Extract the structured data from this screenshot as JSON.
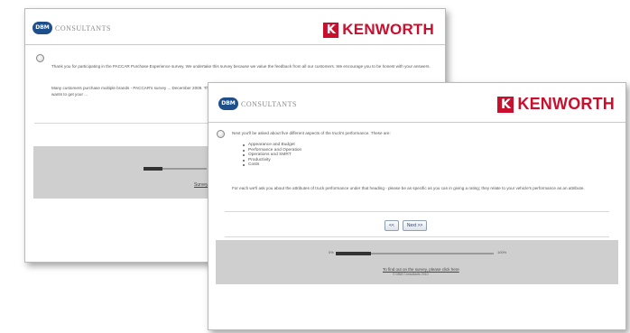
{
  "back_window": {
    "logo_badge": "DBM",
    "logo_text": "CONSULTANTS",
    "brand_mark": "K",
    "brand_name": "KENWORTH",
    "paragraph_1": "Thank you for participating in the PACCAR Purchase Experience survey. We undertake this survey because we value the feedback from all our customers. We encourage you to be honest with your answers.",
    "paragraph_2": "Many customers purchase multiple brands - PACCAR's survey ... December 2009. This survey specifically wants to get your ...",
    "progress_fraction": 0.3,
    "footer_link": "Survey ..."
  },
  "front_window": {
    "logo_badge": "DBM",
    "logo_text": "CONSULTANTS",
    "brand_mark": "K",
    "brand_name": "KENWORTH",
    "intro": "Next you'll be asked about five different aspects of the truck's performance. These are:",
    "aspects": [
      "Appearance and Budget",
      "Performance and Operation",
      "Operations and SMRT",
      "Productivity",
      "Costs"
    ],
    "body": "For each we'll ask you about the attributes of truck performance under that heading - please be as specific as you can in giving a rating; they relate to your vehicle's performance as an attribute.",
    "back_button": "<<",
    "next_button": "Next >>",
    "progress_start": "0%",
    "progress_end": "100%",
    "progress_fraction": 0.22,
    "footer_link": "To find out on the survey, please click here",
    "copyright": "© DBM Consultants 2010"
  }
}
